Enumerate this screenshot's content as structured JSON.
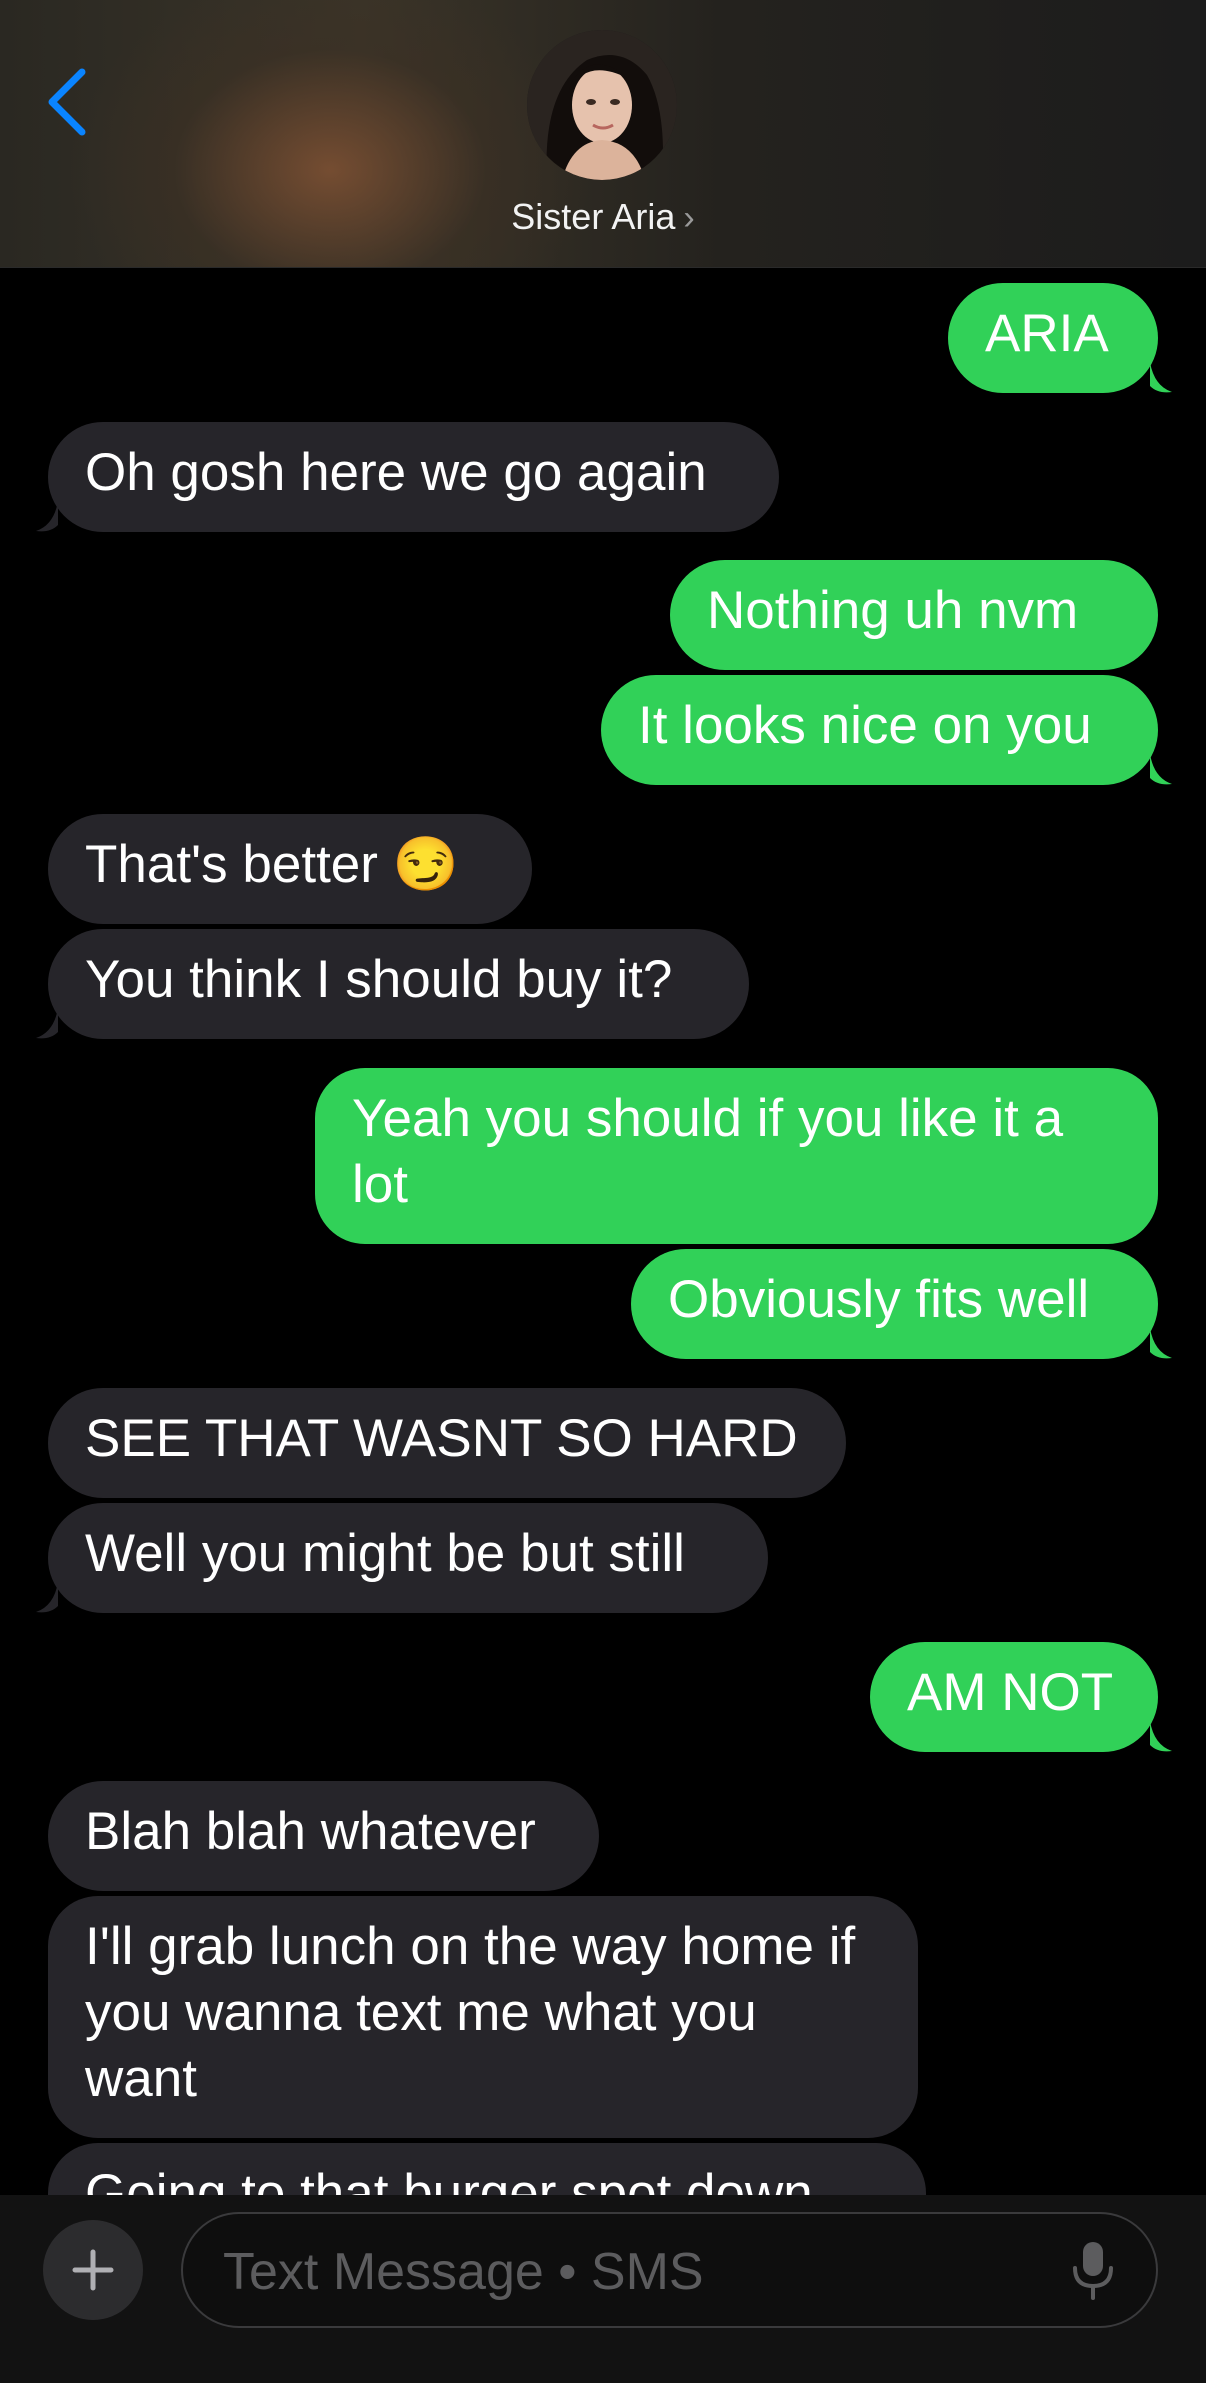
{
  "header": {
    "contact_name": "Sister Aria",
    "contact_chevron": "›",
    "back_icon": "chevron-left-icon",
    "accent": "#0a84ff"
  },
  "messages": [
    {
      "direction": "sent",
      "text": "ARIA"
    },
    {
      "direction": "received",
      "text": "Oh gosh here we go again"
    },
    {
      "direction": "sent",
      "text": "Nothing uh nvm"
    },
    {
      "direction": "sent",
      "text": "It looks nice on you"
    },
    {
      "direction": "received",
      "text": "That's better 😏"
    },
    {
      "direction": "received",
      "text": "You think I should buy it?"
    },
    {
      "direction": "sent",
      "text": "Yeah you should if you like it a lot"
    },
    {
      "direction": "sent",
      "text": "Obviously fits well"
    },
    {
      "direction": "received",
      "text": "SEE THAT WASNT SO HARD"
    },
    {
      "direction": "received",
      "text": "Well you might be but still"
    },
    {
      "direction": "sent",
      "text": "AM NOT"
    },
    {
      "direction": "received",
      "text": "Blah blah whatever"
    },
    {
      "direction": "received",
      "text": "I'll grab lunch on the way home if you wanna text me what you want"
    },
    {
      "direction": "received",
      "text": "Going to that burger spot down"
    }
  ],
  "composer": {
    "placeholder": "Text Message • SMS",
    "value": "",
    "add_icon": "plus-icon",
    "mic_icon": "microphone-icon"
  },
  "colors": {
    "sent_bubble": "#31d158",
    "received_bubble": "#26252a",
    "background": "#000000"
  }
}
